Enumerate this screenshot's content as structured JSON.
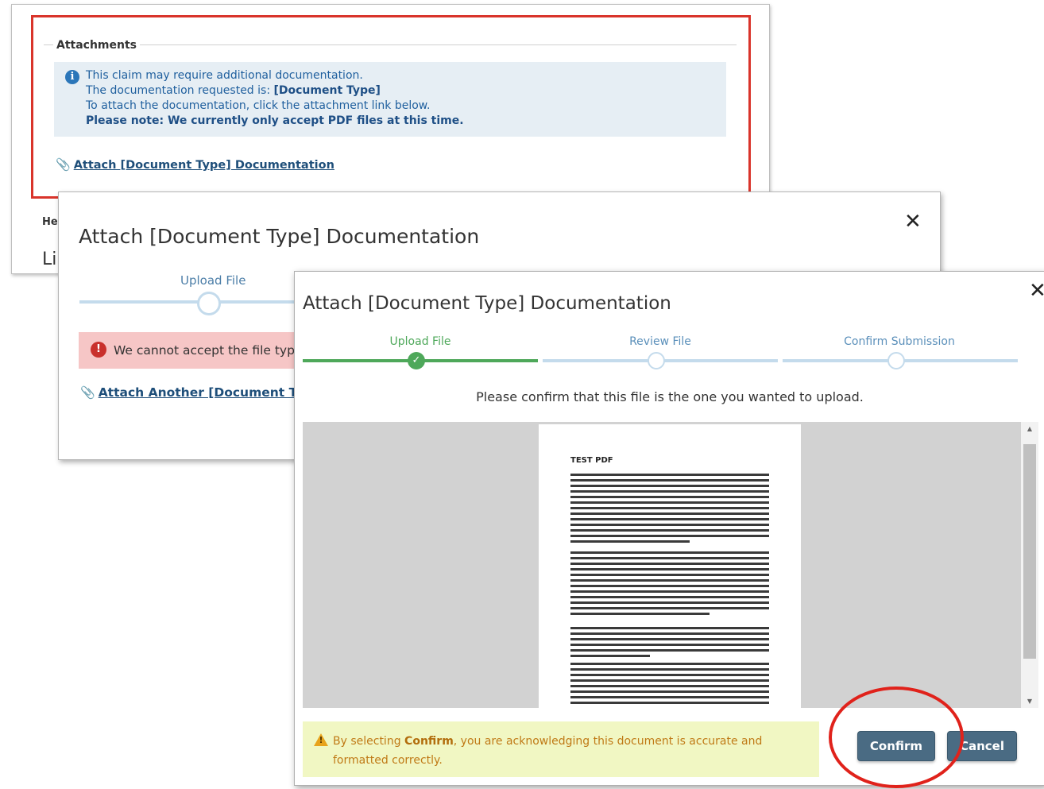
{
  "claim_panel": {
    "legend": "Attachments",
    "info": {
      "line1": "This claim may require additional documentation.",
      "line2_prefix": "The documentation requested is:",
      "line2_value": "[Document Type]",
      "line3": "To attach the documentation, click the attachment link below.",
      "line4": "Please note: We currently only accept PDF files at this time."
    },
    "attach_link": "Attach [Document Type] Documentation",
    "partial_label_1": "He",
    "partial_label_2": "Li"
  },
  "error_modal": {
    "title": "Attach [Document Type] Documentation",
    "close_glyph": "✕",
    "step_label": "Upload File",
    "error_text": "We cannot accept the file type",
    "attach_another_link": "Attach Another [Document Ty"
  },
  "confirm_modal": {
    "title": "Attach [Document Type] Documentation",
    "close_glyph": "✕",
    "steps": [
      {
        "label": "Upload File",
        "state": "done"
      },
      {
        "label": "Review File",
        "state": "pending"
      },
      {
        "label": "Confirm Submission",
        "state": "pending"
      }
    ],
    "prompt": "Please confirm that this file is the one you wanted to upload.",
    "preview_doc_title": "TEST PDF",
    "warning": {
      "before": "By selecting",
      "keyword": "Confirm",
      "after": ", you are acknowledging this document is accurate and formatted correctly."
    },
    "confirm_label": "Confirm",
    "cancel_label": "Cancel"
  },
  "icons": {
    "info": "info-circle-icon",
    "error": "exclamation-circle-icon",
    "attach": "paperclip-icon",
    "warning": "warning-triangle-icon",
    "check": "checkmark-icon",
    "close": "close-icon"
  },
  "colors": {
    "highlight_border": "#d9342b",
    "info_bg": "#e6eef4",
    "error_bg": "#f6c6c6",
    "step_done": "#4ea85a",
    "step_pending": "#c4dbec",
    "warning_bg": "#f1f7c3",
    "button": "#4a6b83",
    "annotation_circle": "#e0221b"
  }
}
